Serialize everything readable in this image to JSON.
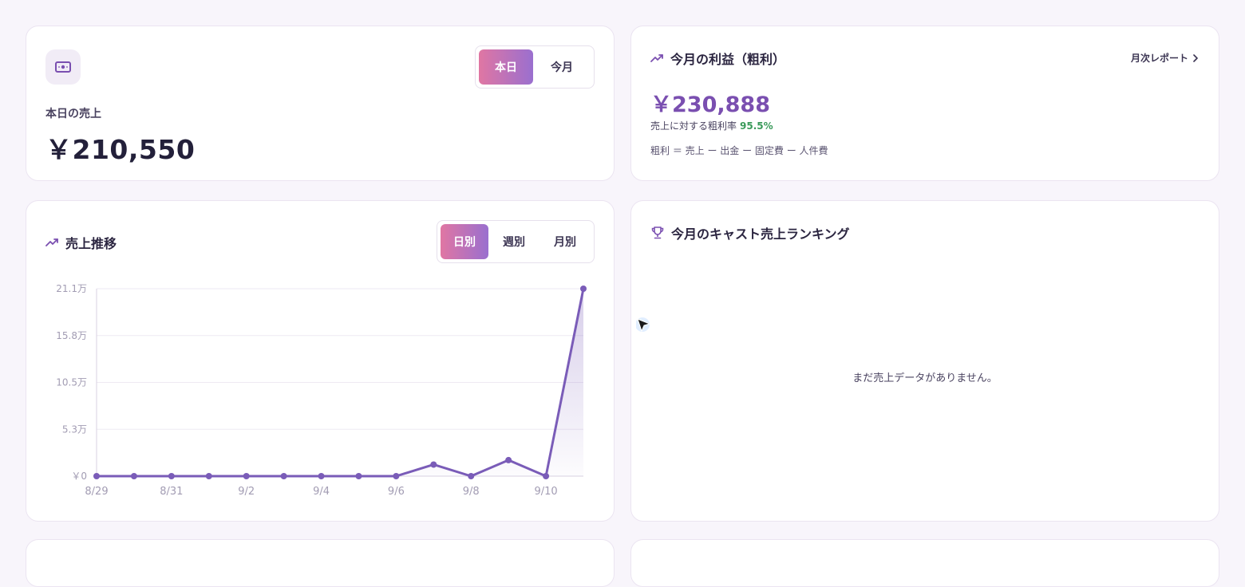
{
  "sales_card": {
    "icon": "money-icon",
    "label": "本日の売上",
    "value": "￥210,550",
    "tabs": [
      {
        "label": "本日",
        "active": true
      },
      {
        "label": "今月",
        "active": false
      }
    ]
  },
  "profit_card": {
    "icon": "trend-up-icon",
    "title": "今月の利益（粗利）",
    "report_link": "月次レポート",
    "value": "￥230,888",
    "rate_label": "売上に対する粗利率",
    "rate_value": "95.5%",
    "formula": "粗利 ＝ 売上 ー 出金 ー 固定費 ー 人件費"
  },
  "trend_card": {
    "icon": "trend-up-icon",
    "title": "売上推移",
    "tabs": [
      {
        "label": "日別",
        "active": true
      },
      {
        "label": "週別",
        "active": false
      },
      {
        "label": "月別",
        "active": false
      }
    ]
  },
  "ranking_card": {
    "icon": "trophy-icon",
    "title": "今月のキャスト売上ランキング",
    "empty_message": "まだ売上データがありません。"
  },
  "colors": {
    "accent": "#7a4fb0",
    "line": "#7a5cb8",
    "gradient_start": "#e076a3",
    "gradient_end": "#9a6fcf",
    "positive": "#3a9a5a"
  },
  "chart_data": {
    "type": "area",
    "x": [
      "8/29",
      "8/30",
      "8/31",
      "9/1",
      "9/2",
      "9/3",
      "9/4",
      "9/5",
      "9/6",
      "9/7",
      "9/8",
      "9/9",
      "9/10",
      "9/11"
    ],
    "values": [
      0,
      0,
      0,
      0,
      0,
      0,
      0,
      0,
      0,
      13000,
      0,
      18000,
      0,
      210550
    ],
    "x_tick_labels": [
      "8/29",
      "8/31",
      "9/2",
      "9/4",
      "9/6",
      "9/8",
      "9/10"
    ],
    "y_tick_labels": [
      "￥0",
      "5.3万",
      "10.5万",
      "15.8万",
      "21.1万"
    ],
    "y_tick_values": [
      0,
      52637,
      105275,
      157912,
      210550
    ],
    "ylim": [
      0,
      210550
    ],
    "grid": true
  }
}
